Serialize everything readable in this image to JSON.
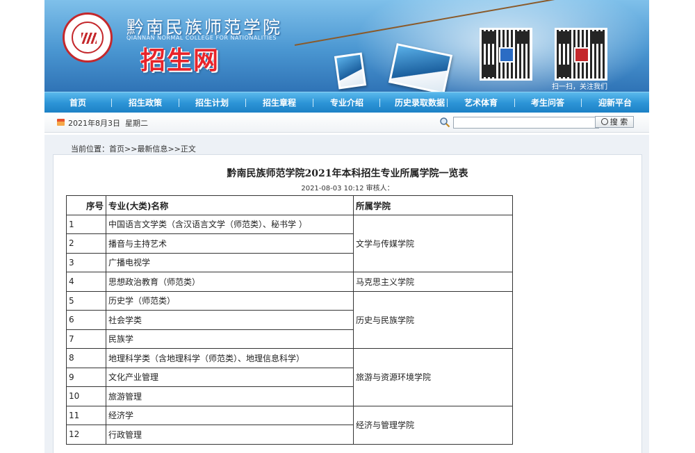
{
  "header": {
    "school_name_cn": "黔南民族师范学院",
    "school_name_en": "QIANNAN NORMAL COLLEGE FOR NATIONALITIES",
    "site_name": "招生网",
    "qr_label": "扫一扫，关注我们"
  },
  "nav": {
    "items": [
      {
        "label": "首页"
      },
      {
        "label": "招生政策"
      },
      {
        "label": "招生计划"
      },
      {
        "label": "招生章程"
      },
      {
        "label": "专业介绍"
      },
      {
        "label": "历史录取数据"
      },
      {
        "label": "艺术体育"
      },
      {
        "label": "考生问答"
      },
      {
        "label": "迎新平台"
      }
    ]
  },
  "infobar": {
    "date": "2021年8月3日",
    "weekday": "星期二",
    "search_value": "",
    "search_button": "搜 索"
  },
  "breadcrumb": {
    "prefix": "当前位置：",
    "home": "首页",
    "sep1": ">>",
    "section": "最新信息",
    "sep2": ">>",
    "current": "正文"
  },
  "article": {
    "title": "黔南民族师范学院2021年本科招生专业所属学院一览表",
    "meta": "2021-08-03 10:12    审核人："
  },
  "table": {
    "headers": [
      "序号",
      "专业(大类)名称",
      "所属学院"
    ],
    "rows": [
      {
        "no": "1",
        "major": "中国语言文学类（含汉语言文学（师范类）、秘书学 ）"
      },
      {
        "no": "2",
        "major": "播音与主持艺术"
      },
      {
        "no": "3",
        "major": "广播电视学"
      },
      {
        "no": "4",
        "major": "思想政治教育（师范类）"
      },
      {
        "no": "5",
        "major": "历史学（师范类）"
      },
      {
        "no": "6",
        "major": "社会学类"
      },
      {
        "no": "7",
        "major": "民族学"
      },
      {
        "no": "8",
        "major": "地理科学类（含地理科学（师范类）、地理信息科学）"
      },
      {
        "no": "9",
        "major": "文化产业管理"
      },
      {
        "no": "10",
        "major": "旅游管理"
      },
      {
        "no": "11",
        "major": "经济学"
      },
      {
        "no": "12",
        "major": "行政管理"
      }
    ],
    "colleges": [
      {
        "name": "文学与传媒学院",
        "rows": 3
      },
      {
        "name": "马克思主义学院",
        "rows": 1
      },
      {
        "name": "历史与民族学院",
        "rows": 3
      },
      {
        "name": "旅游与资源环境学院",
        "rows": 3
      },
      {
        "name": "经济与管理学院",
        "rows": 2
      }
    ]
  }
}
